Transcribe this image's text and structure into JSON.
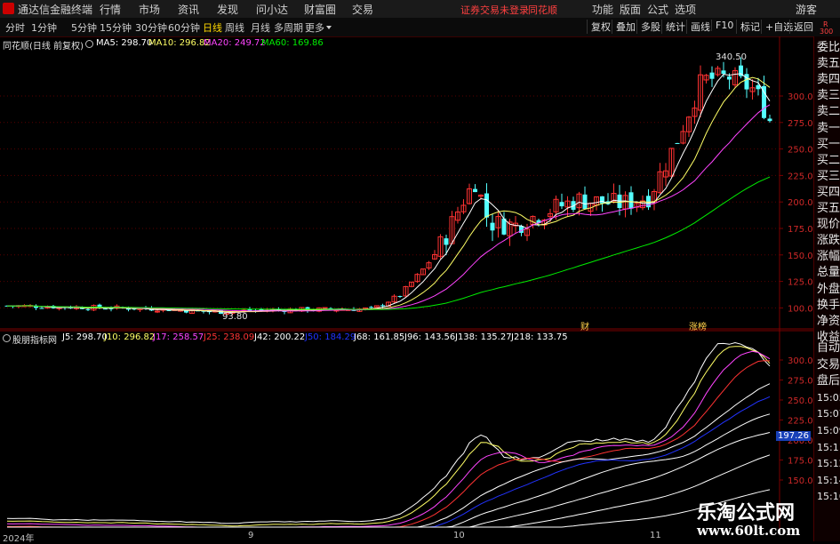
{
  "menubar": {
    "app_title": "通达信金融终端",
    "items": [
      "行情",
      "市场",
      "资讯",
      "发现",
      "问小达",
      "财富圈",
      "交易"
    ],
    "notice": "证券交易未登录",
    "brand": "同花顺",
    "right_items": [
      "功能",
      "版面",
      "公式",
      "选项"
    ],
    "guest": "游客"
  },
  "toolbar": {
    "periods": [
      "分时",
      "1分钟",
      "5分钟",
      "15分钟",
      "30分钟",
      "60分钟",
      "日线",
      "周线",
      "月线",
      "多周期",
      "更多"
    ],
    "active_period": "日线",
    "right_buttons": [
      "复权",
      "叠加",
      "多股",
      "统计",
      "画线",
      "F10",
      "标记",
      "+自选",
      "返回"
    ]
  },
  "main_chart": {
    "title": "同花顺(日线 前复权)",
    "ma": [
      {
        "label": "MA5: 298.70",
        "color": "#ffffff"
      },
      {
        "label": "MA10: 296.82",
        "color": "#ffff66"
      },
      {
        "label": "MA20: 249.72",
        "color": "#ff44ff"
      },
      {
        "label": "MA60: 169.86",
        "color": "#00ee00"
      }
    ],
    "y_ticks": [
      "300.0",
      "275.0",
      "250.0",
      "225.0",
      "200.0",
      "175.0",
      "150.0",
      "125.0",
      "100.0"
    ],
    "y_values": [
      300,
      275,
      250,
      225,
      200,
      175,
      150,
      125,
      100
    ],
    "high_label": "340.50",
    "low_label": "93.80",
    "event_labels": [
      "财",
      "涨榜"
    ]
  },
  "indicator": {
    "name": "股朋指标网",
    "lines": [
      {
        "label": "J5: 298.70",
        "color": "#ffffff"
      },
      {
        "label": "J10: 296.82",
        "color": "#ffff66"
      },
      {
        "label": "J17: 258.57",
        "color": "#ff44ff"
      },
      {
        "label": "J25: 238.09",
        "color": "#ff3333"
      },
      {
        "label": "J42: 200.22",
        "color": "#ffffff"
      },
      {
        "label": "J50: 184.29",
        "color": "#2233ff"
      },
      {
        "label": "J68: 161.85",
        "color": "#ffffff"
      },
      {
        "label": "J96: 143.56",
        "color": "#ffffff"
      },
      {
        "label": "J138: 135.27",
        "color": "#ffffff"
      },
      {
        "label": "J218: 133.75",
        "color": "#ffffff"
      }
    ],
    "y_ticks": [
      "300.0",
      "275.0",
      "250.0",
      "225.0",
      "200.0",
      "175.0",
      "150.0"
    ],
    "y_values": [
      300,
      275,
      250,
      225,
      200,
      175,
      150
    ],
    "price_badge": "197.26"
  },
  "date_axis": [
    "2024年",
    "9",
    "10",
    "11"
  ],
  "sidebar": {
    "badge_top": "R",
    "badge_num": "300",
    "items": [
      "委比",
      "卖五",
      "卖四",
      "卖三",
      "卖二",
      "卖一",
      "买一",
      "买二",
      "买三",
      "买四",
      "买五",
      "现价",
      "涨跌",
      "涨幅",
      "总量",
      "外盘",
      "换手",
      "净资",
      "收益",
      "自动",
      "交易",
      "盘后",
      "15:05",
      "15:07",
      "15:09",
      "15:11",
      "15:12",
      "15:14",
      "15:16"
    ]
  },
  "watermark": {
    "title": "乐淘公式网",
    "url": "www.60lt.com"
  },
  "colors": {
    "up": "#ff3232",
    "down": "#54ffff",
    "ma5": "#ffffff",
    "ma10": "#ffff66",
    "ma20": "#ff44ff",
    "ma60": "#00ee00",
    "axis": "#7a0000"
  }
}
